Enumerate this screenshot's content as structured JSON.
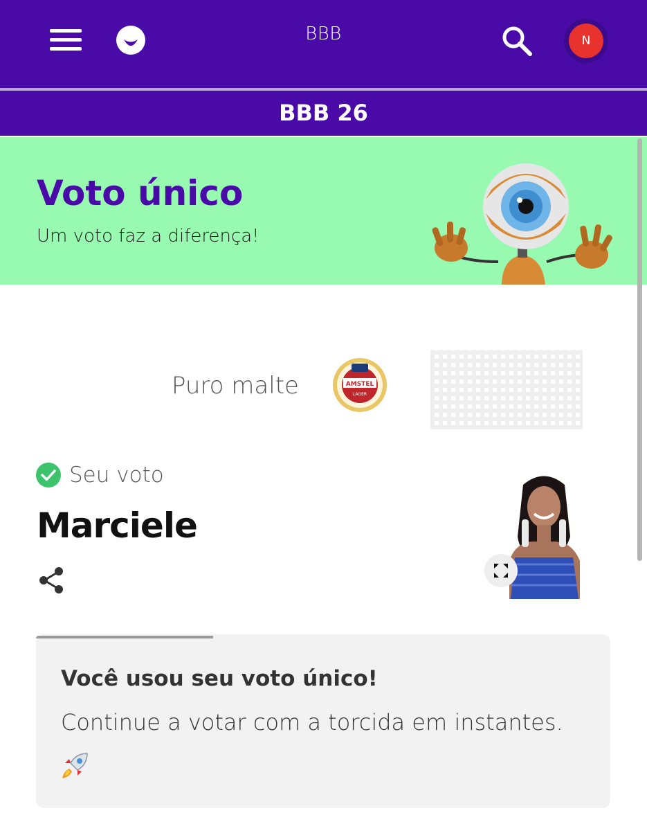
{
  "header": {
    "title": "BBB",
    "menu_icon": "hamburger-menu-icon",
    "logo_icon": "smile-logo-icon",
    "search_icon": "search-icon",
    "avatar_initial": "N",
    "subtitle": "BBB 26",
    "colors": {
      "primary": "#4a0aa8",
      "avatar": "#e8322e"
    }
  },
  "banner": {
    "title": "Voto único",
    "subtitle": "Um voto faz a diferença!",
    "background": "#97fab0"
  },
  "sponsor": {
    "text": "Puro malte",
    "logo": "amstel-lager-logo"
  },
  "vote": {
    "status_label": "Seu voto",
    "candidate": "Marciele",
    "share_icon": "share-icon",
    "expand_icon": "expand-icon",
    "check_color": "#3cc36b"
  },
  "info_card": {
    "title": "Você usou seu voto único!",
    "text": "Continue a votar com a torcida em instantes.",
    "icon": "rocket-icon"
  }
}
